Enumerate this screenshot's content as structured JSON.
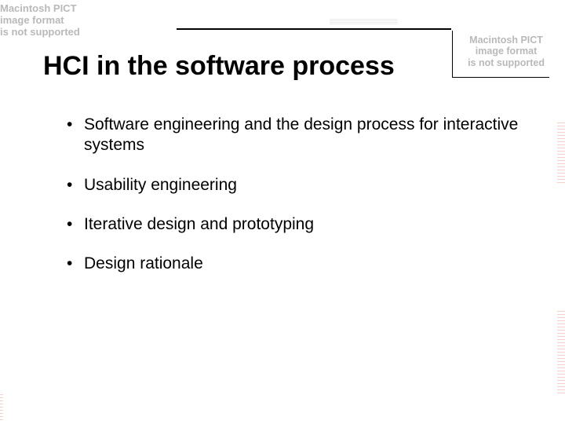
{
  "title": "HCI in the software process",
  "bullets": [
    "Software engineering and the design process for interactive systems",
    "Usability engineering",
    "Iterative design and prototyping",
    "Design rationale"
  ],
  "pict_error": {
    "line1": "Macintosh PICT",
    "line2": "image format",
    "line3": "is not supported"
  }
}
